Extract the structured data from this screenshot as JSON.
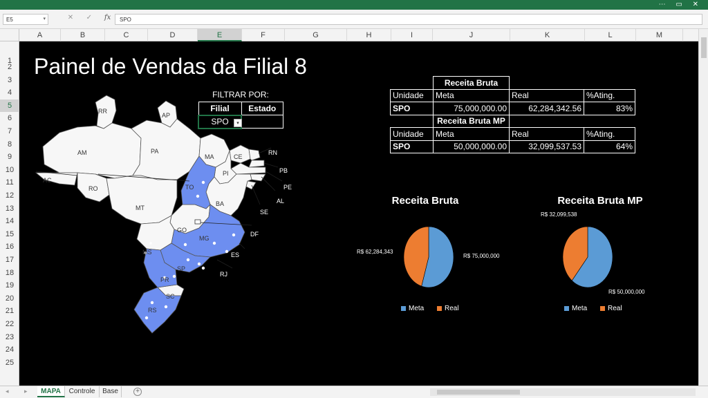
{
  "window": {
    "controls": "⋯  ▭  ✕"
  },
  "formula_bar": {
    "name_box": "E5",
    "formula": "SPO",
    "fx": "fx",
    "cancel": "✕",
    "confirm": "✓"
  },
  "columns": [
    "A",
    "B",
    "C",
    "D",
    "E",
    "F",
    "G",
    "H",
    "I",
    "J",
    "K",
    "L",
    "M"
  ],
  "selected_column": "E",
  "rows": [
    "1",
    "2",
    "3",
    "4",
    "5",
    "6",
    "7",
    "8",
    "9",
    "10",
    "11",
    "12",
    "13",
    "14",
    "15",
    "16",
    "17",
    "18",
    "19",
    "20",
    "21",
    "22",
    "23",
    "24",
    "25"
  ],
  "selected_row": "5",
  "dashboard": {
    "title": "Painel de Vendas da Filial 8",
    "filter": {
      "label": "FILTRAR POR:",
      "col_filial": "Filial",
      "col_estado": "Estado",
      "filial_value": "SPO",
      "estado_value": "",
      "dropdown_glyph": "▾"
    },
    "receita_bruta": {
      "title": "Receita Bruta",
      "headers": [
        "Unidade",
        "Meta",
        "Real",
        "%Ating."
      ],
      "row": {
        "unidade": "SPO",
        "meta": "75,000,000.00",
        "real": "62,284,342.56",
        "ating": "83%"
      }
    },
    "receita_bruta_mp": {
      "title": "Receita Bruta MP",
      "headers": [
        "Unidade",
        "Meta",
        "Real",
        "%Ating."
      ],
      "row": {
        "unidade": "SPO",
        "meta": "50,000,000.00",
        "real": "32,099,537.53",
        "ating": "64%"
      }
    }
  },
  "map": {
    "states": [
      "RR",
      "AP",
      "AM",
      "PA",
      "MA",
      "CE",
      "RN",
      "PB",
      "PE",
      "AL",
      "SE",
      "PI",
      "TO",
      "BA",
      "AC",
      "RO",
      "MT",
      "GO",
      "DF",
      "MS",
      "MG",
      "ES",
      "SP",
      "RJ",
      "PR",
      "SC",
      "RS"
    ],
    "highlighted": [
      "TO",
      "MG",
      "SP",
      "PR",
      "RS"
    ],
    "colors": {
      "highlight": "#6d8ef0",
      "default": "#f7f7f7",
      "border": "#555555"
    }
  },
  "chart_data": [
    {
      "type": "pie",
      "title": "Receita Bruta",
      "categories": [
        "Meta",
        "Real"
      ],
      "values": [
        75000000,
        62284343
      ],
      "data_labels": [
        "R$ 75,000,000",
        "R$ 62,284,343"
      ],
      "colors": [
        "#5b9bd5",
        "#ed7d31"
      ],
      "legend": "bottom"
    },
    {
      "type": "pie",
      "title": "Receita Bruta MP",
      "categories": [
        "Meta",
        "Real"
      ],
      "values": [
        50000000,
        32099538
      ],
      "data_labels": [
        "R$ 50,000,000",
        "R$ 32,099,538"
      ],
      "colors": [
        "#5b9bd5",
        "#ed7d31"
      ],
      "legend": "bottom"
    }
  ],
  "sheet_tabs": [
    {
      "label": "MAPA",
      "active": true
    },
    {
      "label": "Controle",
      "active": false
    },
    {
      "label": "Base",
      "active": false
    }
  ],
  "tab_add": "+",
  "tab_nav": "◂ ▸"
}
